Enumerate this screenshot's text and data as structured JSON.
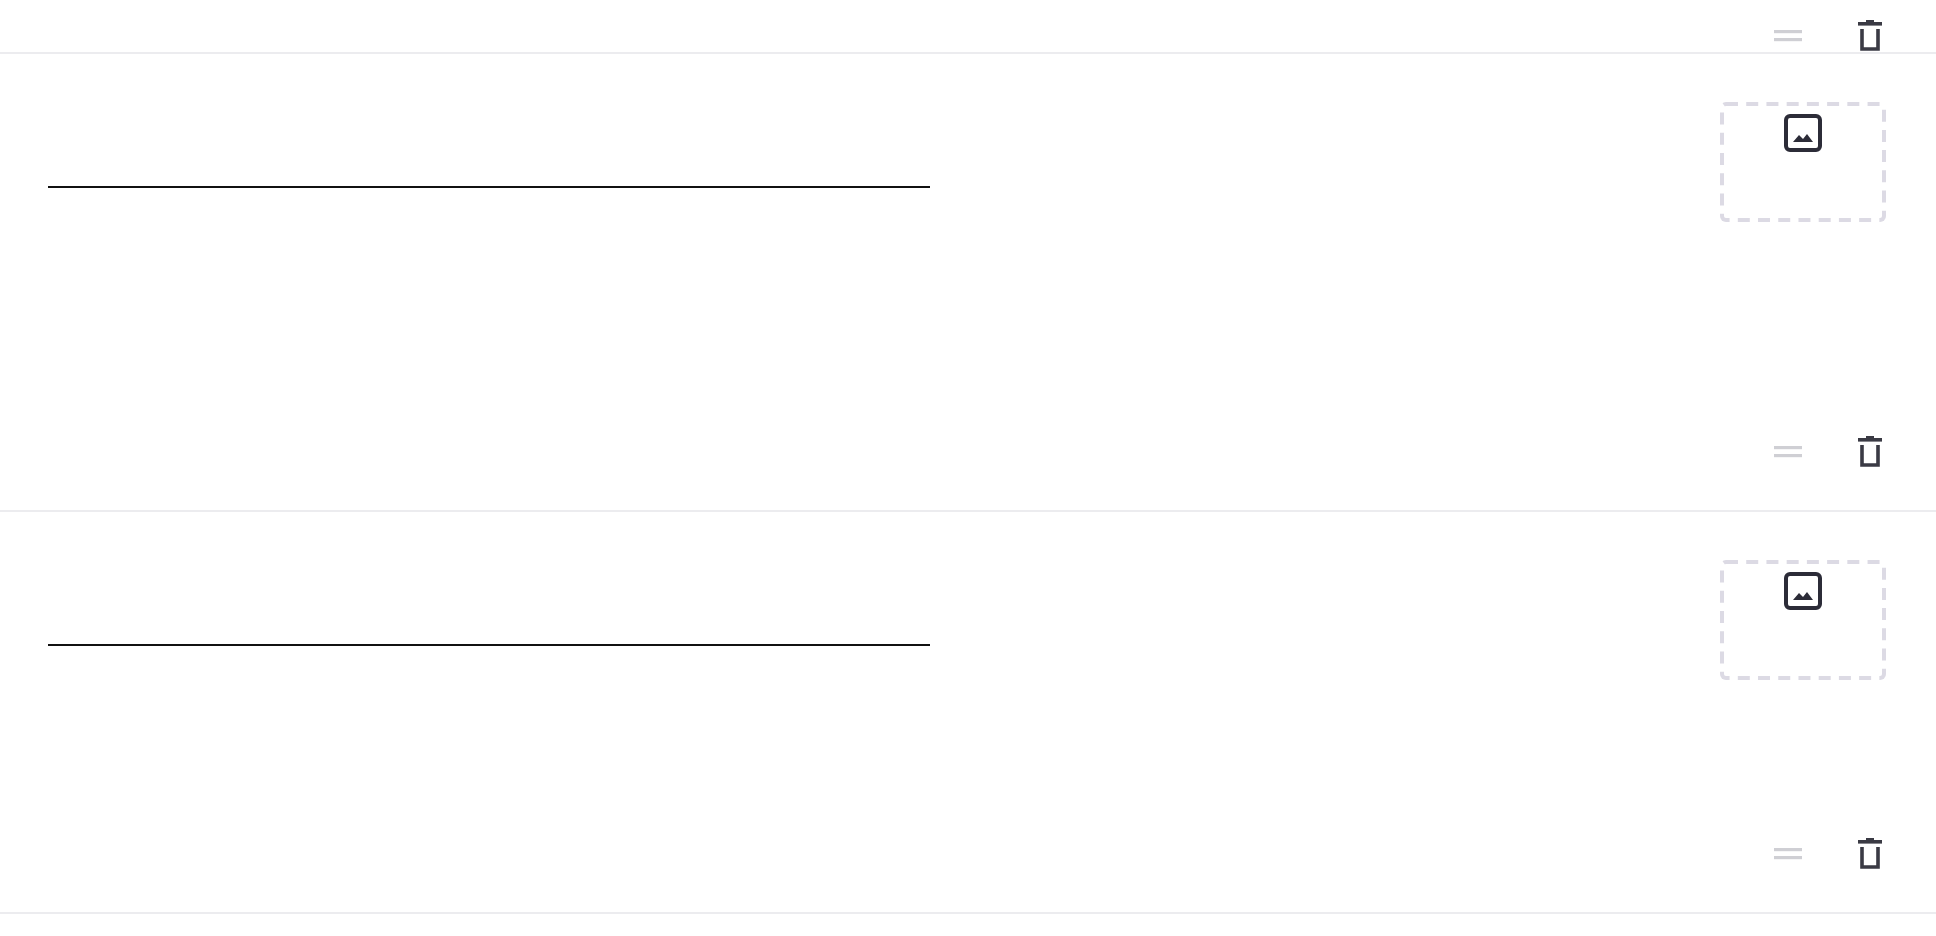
{
  "rows": [
    {
      "kind": "actions"
    },
    {
      "kind": "question"
    },
    {
      "kind": "question"
    }
  ]
}
